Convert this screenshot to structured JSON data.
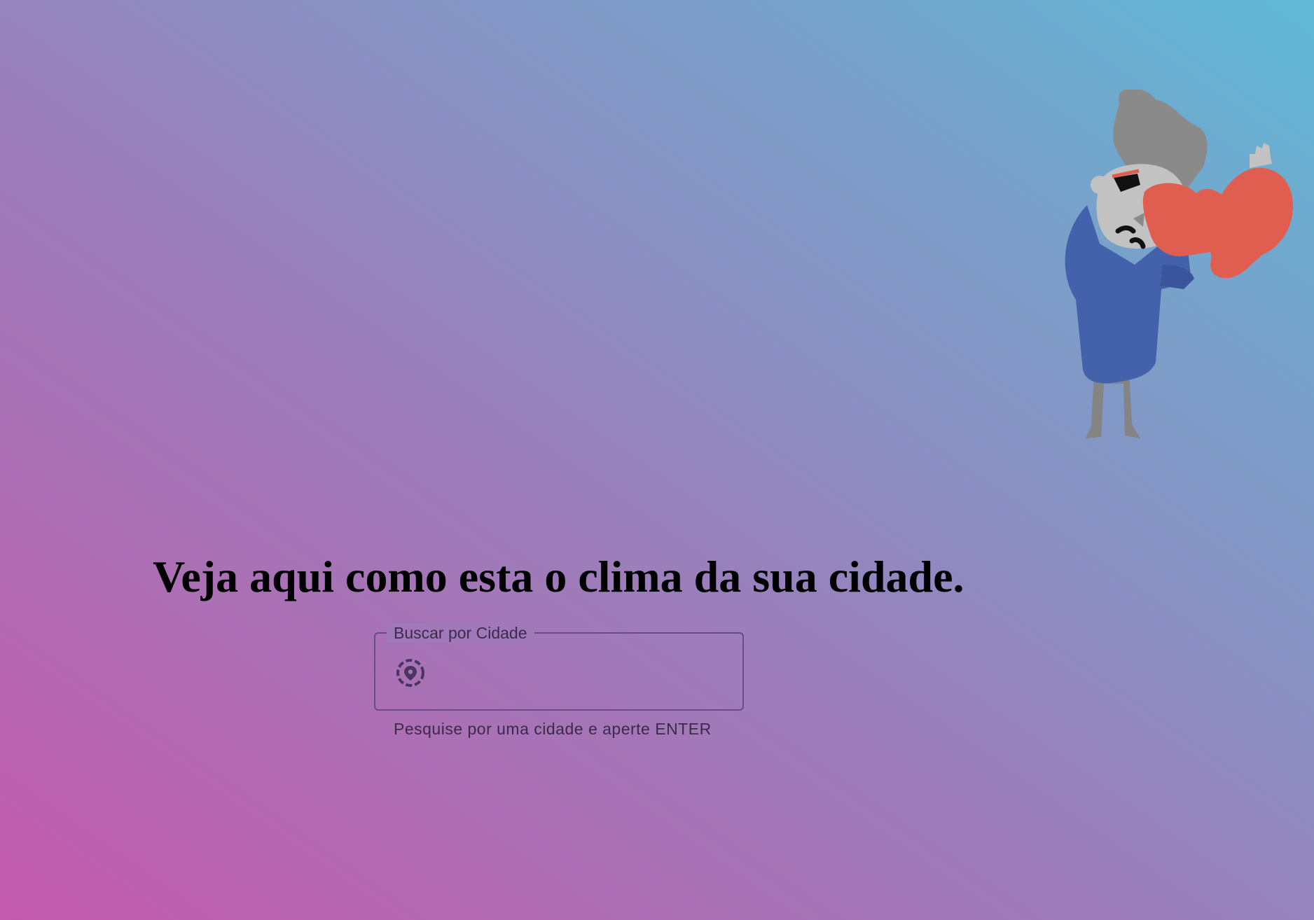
{
  "headline": "Veja aqui como esta o clima da sua cidade.",
  "search": {
    "label": "Buscar por Cidade",
    "value": "",
    "placeholder": "",
    "helper_text": "Pesquise por uma cidade e aperte ENTER",
    "icon": "location-search-icon"
  },
  "illustration": {
    "icon": "windswept-person-illustration"
  },
  "colors": {
    "gradient_bottom_left": "#c35aab",
    "gradient_top_right": "#5fb9d6",
    "field_outline": "#6b4c88",
    "helper_text": "#3b2a4c",
    "sweater": "#4461ab",
    "scarf": "#df5e50",
    "hair": "#8a8a8a"
  }
}
